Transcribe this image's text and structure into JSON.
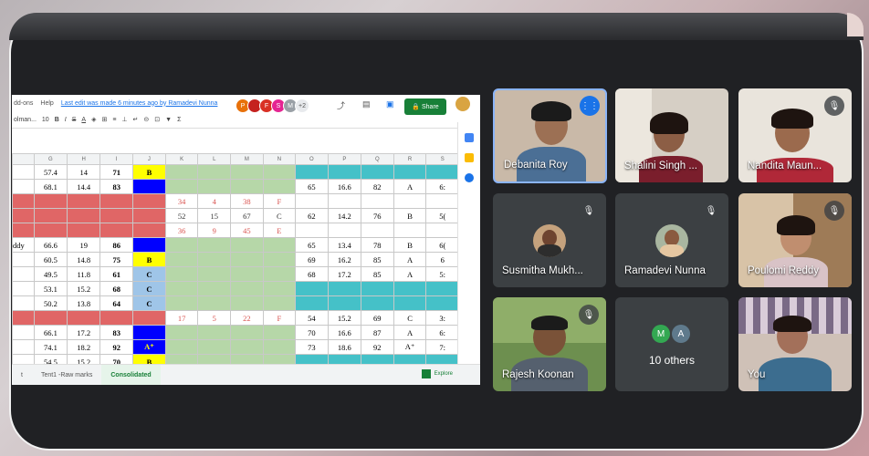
{
  "sheet": {
    "menu": [
      "dd-ons",
      "Help"
    ],
    "last_edit": "Last edit was made 6 minutes ago by Ramadevi Nunna",
    "avatars": [
      {
        "letter": "P",
        "color": "#e8710a"
      },
      {
        "letter": "",
        "color": "#c5221f"
      },
      {
        "letter": "F",
        "color": "#d93025"
      },
      {
        "letter": "S",
        "color": "#e52592"
      },
      {
        "letter": "M",
        "color": "#9aa0a6"
      },
      {
        "letter": "+2",
        "color": "#e8eaed"
      }
    ],
    "share_label": "Share",
    "font_name": "olman...",
    "font_size": "10",
    "column_headers": [
      "G",
      "H",
      "I",
      "J",
      "K",
      "L",
      "M",
      "N",
      "O",
      "P",
      "Q",
      "R",
      "S"
    ],
    "rows": [
      [
        "57.4",
        "14",
        "71",
        "B",
        "",
        "",
        "",
        "",
        "",
        "",
        "",
        "",
        ""
      ],
      [
        "68.1",
        "14.4",
        "83",
        "",
        "",
        "",
        "",
        "",
        "65",
        "16.6",
        "82",
        "A",
        "6:"
      ],
      [
        "",
        "",
        "",
        "",
        "34",
        "4",
        "38",
        "F",
        "",
        "",
        "",
        "",
        ""
      ],
      [
        "",
        "",
        "",
        "",
        "52",
        "15",
        "67",
        "C",
        "62",
        "14.2",
        "76",
        "B",
        "5("
      ],
      [
        "",
        "",
        "",
        "",
        "36",
        "9",
        "45",
        "E",
        "",
        "",
        "",
        "",
        ""
      ],
      [
        "66.6",
        "19",
        "86",
        "",
        "",
        "",
        "",
        "",
        "65",
        "13.4",
        "78",
        "B",
        "6("
      ],
      [
        "60.5",
        "14.8",
        "75",
        "B",
        "",
        "",
        "",
        "",
        "69",
        "16.2",
        "85",
        "A",
        "6"
      ],
      [
        "49.5",
        "11.8",
        "61",
        "C",
        "",
        "",
        "",
        "",
        "68",
        "17.2",
        "85",
        "A",
        "5:"
      ],
      [
        "53.1",
        "15.2",
        "68",
        "C",
        "",
        "",
        "",
        "",
        "",
        "",
        "",
        "",
        ""
      ],
      [
        "50.2",
        "13.8",
        "64",
        "C",
        "",
        "",
        "",
        "",
        "",
        "",
        "",
        "",
        ""
      ],
      [
        "",
        "",
        "",
        "",
        "17",
        "5",
        "22",
        "F",
        "54",
        "15.2",
        "69",
        "C",
        "3:"
      ],
      [
        "66.1",
        "17.2",
        "83",
        "",
        "",
        "",
        "",
        "",
        "70",
        "16.6",
        "87",
        "A",
        "6:"
      ],
      [
        "74.1",
        "18.2",
        "92",
        "A⁺",
        "",
        "",
        "",
        "",
        "73",
        "18.6",
        "92",
        "A⁺",
        "7:"
      ],
      [
        "54.5",
        "15.2",
        "70",
        "B",
        "",
        "",
        "",
        "",
        "",
        "",
        "",
        "",
        ""
      ]
    ],
    "row_prefix": [
      "",
      "",
      "",
      "",
      "",
      "ddy",
      "",
      "",
      "",
      "",
      "",
      "",
      "",
      ""
    ],
    "tabs": [
      "t",
      "Tent1 -Raw marks",
      "Consolidated"
    ],
    "explore_label": "Explore"
  },
  "participants": [
    {
      "name": "Debanita Roy",
      "speaking": true
    },
    {
      "name": "Shalini Singh ...",
      "speaking": false
    },
    {
      "name": "Nandita Maun...",
      "speaking": false
    },
    {
      "name": "Susmitha Mukh...",
      "speaking": false
    },
    {
      "name": "Ramadevi Nunna",
      "speaking": false
    },
    {
      "name": "Poulomi Reddy",
      "speaking": false
    },
    {
      "name": "Rajesh Koonan",
      "speaking": false
    },
    {
      "name": "10 others",
      "speaking": false
    },
    {
      "name": "You",
      "speaking": false
    }
  ],
  "others_avatars": [
    "M",
    "A"
  ],
  "colors": {
    "speaking_border": "#8ab4f8",
    "red_cell": "#e06666",
    "green_cell": "#b6d7a8",
    "teal_cell": "#45c1c8",
    "yellow_cell": "#ffff00",
    "blue_cell": "#0000ff",
    "light_blue_cell": "#9fc5e8",
    "share_green": "#188038"
  }
}
